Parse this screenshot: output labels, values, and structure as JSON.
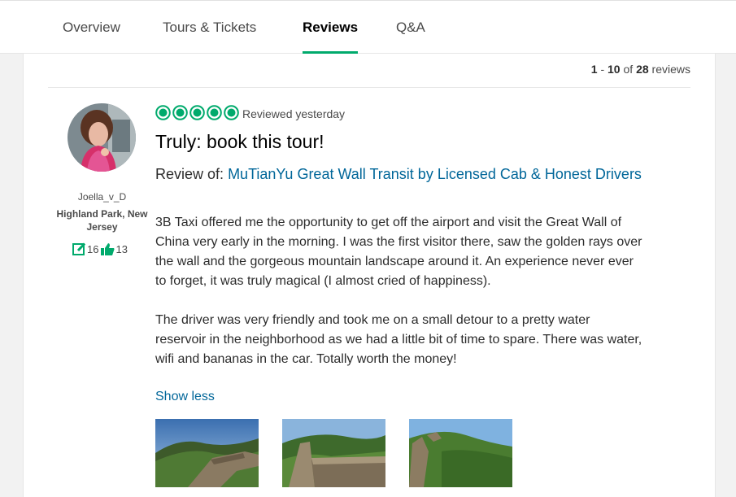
{
  "nav": {
    "tabs": [
      {
        "label": "Overview"
      },
      {
        "label": "Tours & Tickets"
      },
      {
        "label": "Reviews",
        "active": true
      },
      {
        "label": "Q&A"
      }
    ]
  },
  "reviews_count": {
    "range_start": "1",
    "range_end": "10",
    "of": "of",
    "total": "28",
    "suffix": "reviews"
  },
  "review": {
    "user": {
      "name": "Joella_v_D",
      "location": "Highland Park, New Jersey",
      "contributions": "16",
      "helpful_votes": "13"
    },
    "rating": 5,
    "rating_max": 5,
    "reviewed_date": "Reviewed yesterday",
    "title": "Truly: book this tour!",
    "review_of_label": "Review of:",
    "review_of_link": "MuTianYu Great Wall Transit by Licensed Cab & Honest Drivers",
    "body": [
      "3B Taxi offered me the opportunity to get off the airport and visit the Great Wall of China very early in the morning. I was the first visitor there, saw the golden rays over the wall and the gorgeous mountain landscape around it. An experience never ever to forget, it was truly magical (I almost cried of happiness).",
      "The driver was very friendly and took me on a small detour to a pretty water reservoir in the neighborhood as we had a little bit of time to spare. There was water, wifi and bananas in the car. Totally worth the money!"
    ],
    "show_less": "Show less"
  },
  "colors": {
    "accent": "#00aa6c",
    "link": "#006699"
  },
  "icons": {
    "contributions": "pencil-box-icon",
    "helpful": "thumbs-up-icon",
    "rating": "rating-bubble-icon"
  }
}
